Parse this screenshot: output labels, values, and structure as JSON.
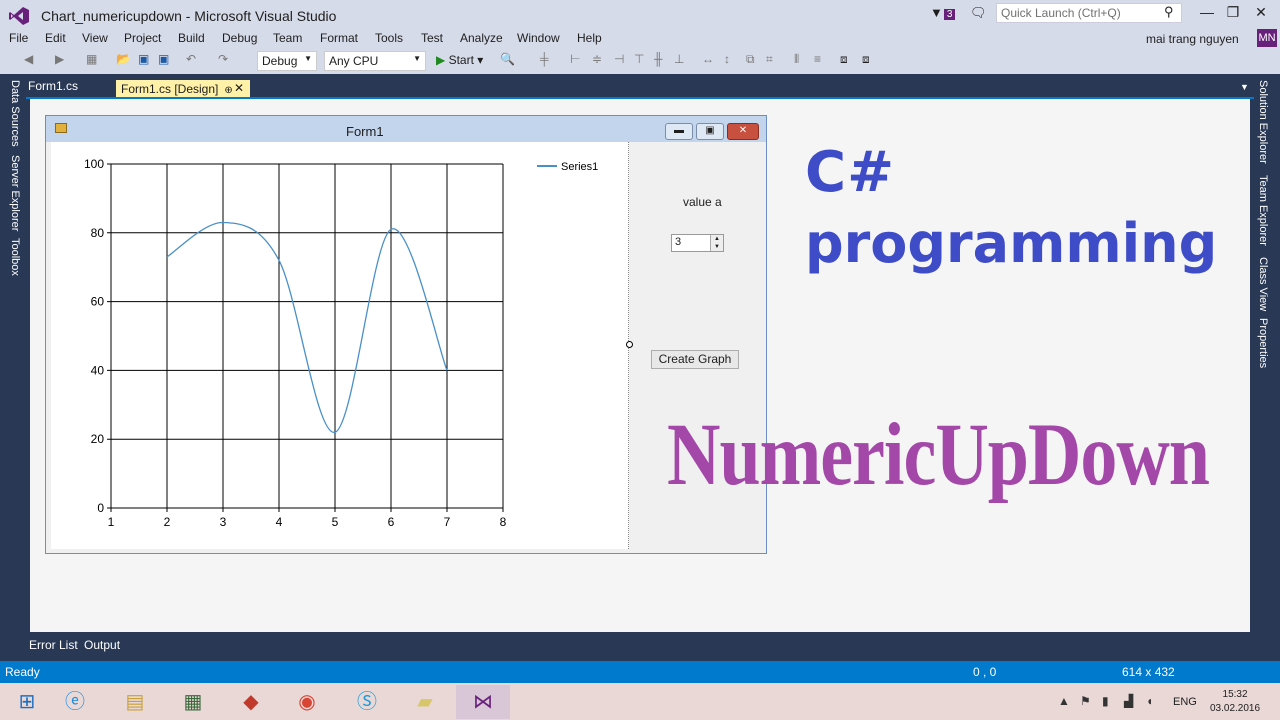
{
  "window": {
    "title": "Chart_numericupdown - Microsoft Visual Studio",
    "notification_count": "3",
    "quick_launch_placeholder": "Quick Launch (Ctrl+Q)",
    "user_name": "mai trang nguyen",
    "user_initials": "MN"
  },
  "menu": [
    "File",
    "Edit",
    "View",
    "Project",
    "Build",
    "Debug",
    "Team",
    "Format",
    "Tools",
    "Test",
    "Analyze",
    "Window",
    "Help"
  ],
  "toolbar": {
    "config": "Debug",
    "platform": "Any CPU",
    "start_label": "Start"
  },
  "left_panels": [
    "Data Sources",
    "Server Explorer",
    "Toolbox"
  ],
  "right_panels": [
    "Solution Explorer",
    "Team Explorer",
    "Class View",
    "Properties"
  ],
  "doc_tabs": {
    "tab1": "Form1.cs",
    "tab2": "Form1.cs [Design]"
  },
  "form": {
    "title": "Form1",
    "value_label": "value a",
    "numeric_value": "3",
    "create_button": "Create Graph"
  },
  "overlay": {
    "line1": "C#",
    "line2": "programming",
    "line3": "NumericUpDown"
  },
  "bottom_tabs": [
    "Error List",
    "Output"
  ],
  "status": {
    "ready": "Ready",
    "position": "0 , 0",
    "size": "614 x 432"
  },
  "tray": {
    "lang": "ENG",
    "time": "15:32",
    "date": "03.02.2016"
  },
  "chart_data": {
    "type": "line",
    "series": [
      {
        "name": "Series1",
        "x": [
          2,
          3,
          4,
          5,
          6,
          7
        ],
        "values": [
          73,
          83,
          72,
          22,
          81,
          40
        ]
      }
    ],
    "xlim": [
      1,
      8
    ],
    "ylim": [
      0,
      100
    ],
    "x_ticks": [
      1,
      2,
      3,
      4,
      5,
      6,
      7,
      8
    ],
    "y_ticks": [
      0,
      20,
      40,
      60,
      80,
      100
    ],
    "grid": true,
    "smooth": true,
    "legend": "top-right",
    "line_color": "#4a90c8"
  }
}
